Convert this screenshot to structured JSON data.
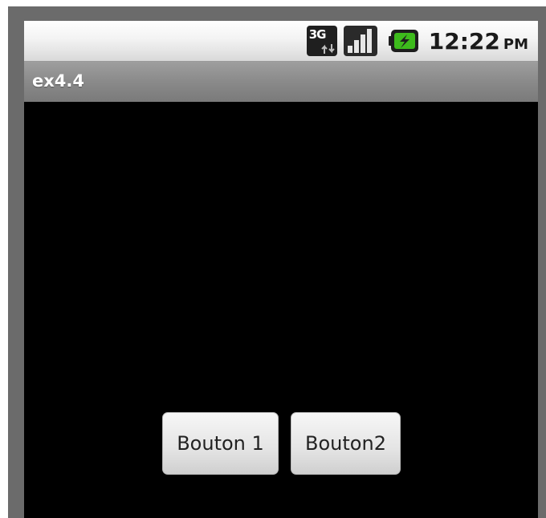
{
  "status_bar": {
    "network_type": "3G",
    "network_icon": "3g-data-icon",
    "signal_icon": "signal-strength-icon",
    "battery_icon": "battery-charging-icon",
    "time": "12:22",
    "ampm": "PM"
  },
  "app": {
    "title": "ex4.4"
  },
  "buttons": [
    {
      "label": "Bouton 1"
    },
    {
      "label": "Bouton2"
    }
  ],
  "colors": {
    "screen_background": "#000000",
    "battery_green": "#3dbb1c",
    "title_bar": "#8a8a8a"
  }
}
